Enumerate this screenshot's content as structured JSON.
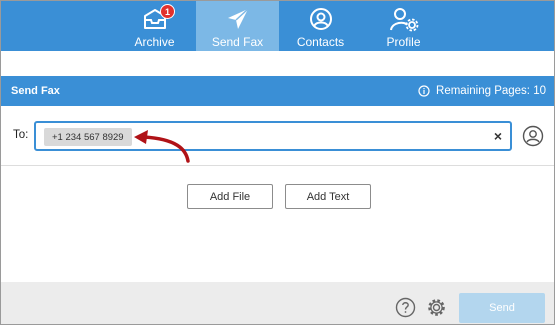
{
  "nav": {
    "tabs": [
      {
        "label": "Archive",
        "icon": "inbox-icon",
        "badge": "1"
      },
      {
        "label": "Send Fax",
        "icon": "paper-plane-icon",
        "active": true
      },
      {
        "label": "Contacts",
        "icon": "user-circle-icon"
      },
      {
        "label": "Profile",
        "icon": "user-settings-icon"
      }
    ]
  },
  "header": {
    "title": "Send Fax",
    "remaining": "Remaining Pages: 10"
  },
  "to": {
    "label": "To:",
    "recipient": "+1 234 567 8929",
    "clear": "×"
  },
  "actions": {
    "add_file": "Add File",
    "add_text": "Add Text"
  },
  "footer": {
    "send": "Send"
  },
  "colors": {
    "primary": "#3a8fd6",
    "active_tab": "#7cb8e6",
    "badge": "#e2312d",
    "annotation_arrow": "#b01217",
    "send_disabled": "#b3d6ee"
  }
}
